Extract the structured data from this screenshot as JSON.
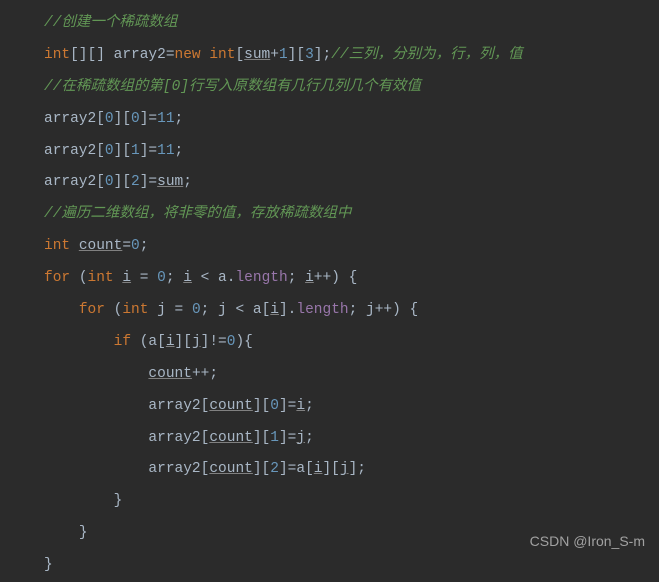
{
  "lines": {
    "l01_c1": "//创建一个稀疏数组",
    "l02_kw1": "int",
    "l02_t1": "[][] array2=",
    "l02_kw2": "new ",
    "l02_kw3": "int",
    "l02_t2": "[",
    "l02_u1": "sum",
    "l02_t3": "+",
    "l02_n1": "1",
    "l02_t4": "][",
    "l02_n2": "3",
    "l02_t5": "];",
    "l02_c1": "//三列，分别为，行，列，值",
    "l03_c1": "//在稀疏数组的第[0]行写入原数组有几行几列几个有效值",
    "l04_t1": "array2[",
    "l04_n1": "0",
    "l04_t2": "][",
    "l04_n2": "0",
    "l04_t3": "]=",
    "l04_n3": "11",
    "l04_t4": ";",
    "l05_t1": "array2[",
    "l05_n1": "0",
    "l05_t2": "][",
    "l05_n2": "1",
    "l05_t3": "]=",
    "l05_n3": "11",
    "l05_t4": ";",
    "l06_t1": "array2[",
    "l06_n1": "0",
    "l06_t2": "][",
    "l06_n2": "2",
    "l06_t3": "]=",
    "l06_u1": "sum",
    "l06_t4": ";",
    "l07_c1": "//遍历二维数组，将非零的值，存放稀疏数组中",
    "l08_kw1": "int ",
    "l08_u1": "count",
    "l08_t1": "=",
    "l08_n1": "0",
    "l08_t2": ";",
    "l09_kw1": "for ",
    "l09_t1": "(",
    "l09_kw2": "int ",
    "l09_u1": "i",
    "l09_t2": " = ",
    "l09_n1": "0",
    "l09_t3": "; ",
    "l09_u2": "i",
    "l09_t4": " < a.",
    "l09_fld1": "length",
    "l09_t5": "; ",
    "l09_u3": "i",
    "l09_t6": "++) {",
    "l10_kw1": "for ",
    "l10_t1": "(",
    "l10_kw2": "int ",
    "l10_t2": "j = ",
    "l10_n1": "0",
    "l10_t3": "; j < a[",
    "l10_u1": "i",
    "l10_t4": "].",
    "l10_fld1": "length",
    "l10_t5": "; j++) {",
    "l11_kw1": "if ",
    "l11_t1": "(a[",
    "l11_u1": "i",
    "l11_t2": "][",
    "l11_u2": "j",
    "l11_t3": "]!=",
    "l11_n1": "0",
    "l11_t4": "){",
    "l12_u1": "count",
    "l12_t1": "++;",
    "l13_t1": "array2[",
    "l13_u1": "count",
    "l13_t2": "][",
    "l13_n1": "0",
    "l13_t3": "]=",
    "l13_u2": "i",
    "l13_t4": ";",
    "l14_t1": "array2[",
    "l14_u1": "count",
    "l14_t2": "][",
    "l14_n1": "1",
    "l14_t3": "]=",
    "l14_u2": "j",
    "l14_t4": ";",
    "l15_t1": "array2[",
    "l15_u1": "count",
    "l15_t2": "][",
    "l15_n1": "2",
    "l15_t3": "]=a[",
    "l15_u2": "i",
    "l15_t4": "][",
    "l15_u3": "j",
    "l15_t5": "];",
    "l16_t1": "}",
    "l17_t1": "}",
    "l18_t1": "}"
  },
  "watermark": "CSDN @Iron_S-m"
}
